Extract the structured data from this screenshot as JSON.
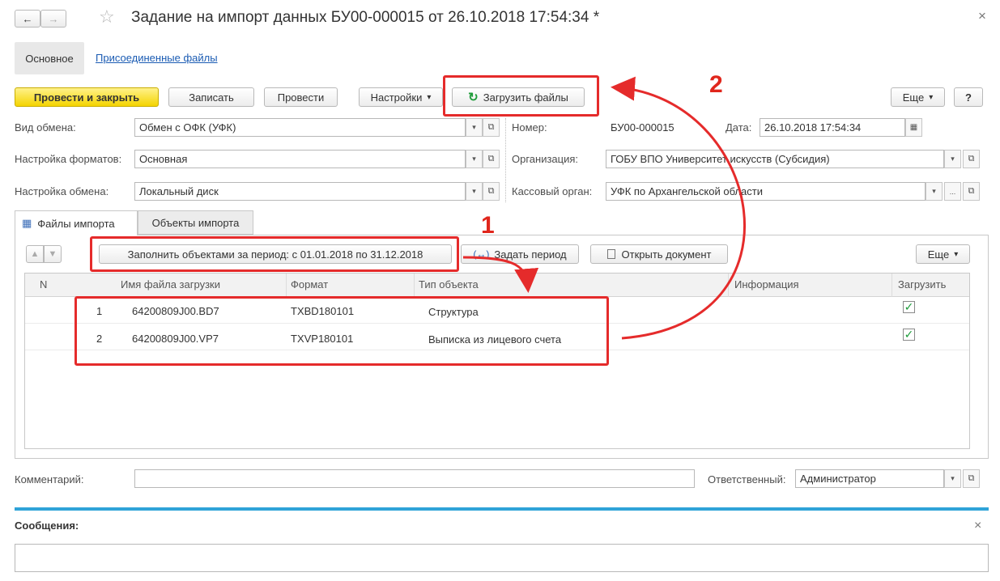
{
  "window": {
    "title": "Задание на импорт данных БУ00-000015 от 26.10.2018 17:54:34 *",
    "close_glyph": "×"
  },
  "nav": {
    "back": "←",
    "forward": "→",
    "favorite": "☆"
  },
  "form_tabs": {
    "main": "Основное",
    "attached": "Присоединенные файлы"
  },
  "toolbar": {
    "post_close": "Провести и закрыть",
    "save": "Записать",
    "post": "Провести",
    "settings": "Настройки",
    "settings_arrow": "▾",
    "load_files": "Загрузить файлы",
    "more": "Еще",
    "more_arrow": "▾",
    "help": "?"
  },
  "fields": {
    "exchange_type_label": "Вид обмена:",
    "exchange_type_value": "Обмен с ОФК (УФК)",
    "format_settings_label": "Настройка форматов:",
    "format_settings_value": "Основная",
    "exchange_settings_label": "Настройка обмена:",
    "exchange_settings_value": "Локальный диск",
    "number_label": "Номер:",
    "number_value": "БУ00-000015",
    "date_label": "Дата:",
    "date_value": "26.10.2018 17:54:34",
    "org_label": "Организация:",
    "org_value": "ГОБУ ВПО Университет искусств (Субсидия)",
    "cash_label": "Кассовый орган:",
    "cash_value": "УФК по Архангельской области",
    "dd_arrow": "▾",
    "open_glyph": "⧉",
    "dots": "..."
  },
  "sub_tabs": {
    "import_files": "Файлы импорта",
    "import_objects": "Объекты импорта"
  },
  "table_toolbar": {
    "up": "🠕",
    "down": "🠗",
    "fill": "Заполнить объектами за период: с 01.01.2018 по 31.12.2018",
    "set_period": "Задать период",
    "set_period_glyph": "(↔)",
    "open_doc": "Открыть документ",
    "more": "Еще",
    "more_arrow": "▾"
  },
  "table": {
    "headers": {
      "n": "N",
      "filename": "Имя файла загрузки",
      "format": "Формат",
      "type": "Тип объекта",
      "info": "Информация",
      "load": "Загрузить"
    },
    "rows": [
      {
        "n": "1",
        "filename": "64200809J00.BD7",
        "format": "TXBD180101",
        "type": "Структура",
        "info": "",
        "checked": "✓"
      },
      {
        "n": "2",
        "filename": "64200809J00.VP7",
        "format": "TXVP180101",
        "type": "Выписка из лицевого счета",
        "info": "",
        "checked": "✓"
      }
    ]
  },
  "bottom": {
    "comment_label": "Комментарий:",
    "comment_value": "",
    "responsible_label": "Ответственный:",
    "responsible_value": "Администратор"
  },
  "messages": {
    "title": "Сообщения:",
    "close_glyph": "×",
    "value": ""
  },
  "annotations": {
    "num1": "1",
    "num2": "2",
    "color": "#e52b2b"
  }
}
